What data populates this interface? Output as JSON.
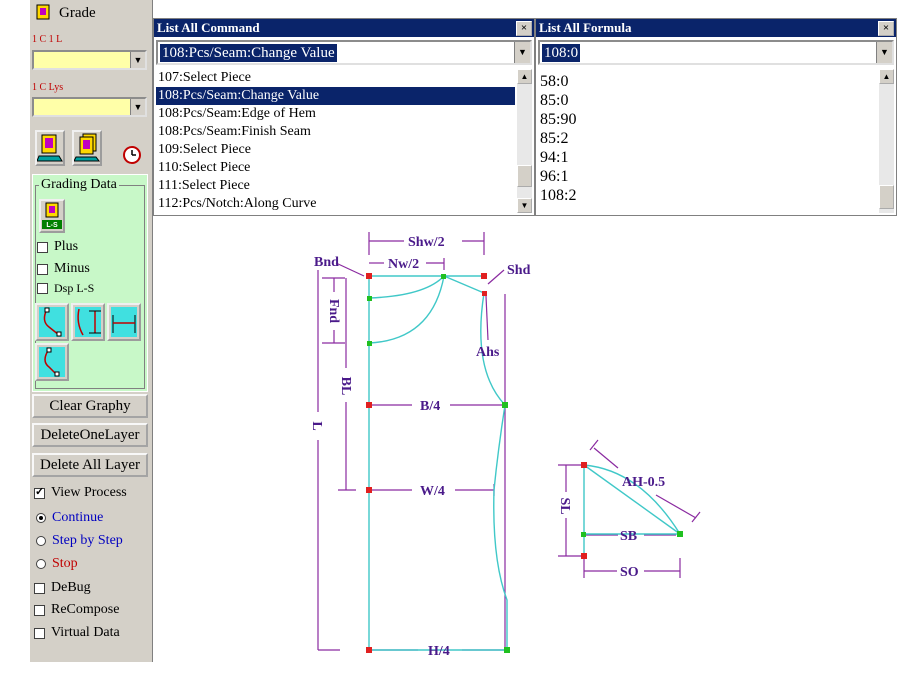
{
  "panel": {
    "title": "Grade",
    "label_1": "1 C 1 L",
    "label_2": "1 C Lys",
    "grading_legend": "Grading Data",
    "ls_button": "L-S",
    "checks": [
      {
        "label": "Plus",
        "checked": false
      },
      {
        "label": "Minus",
        "checked": false
      },
      {
        "label": "Dsp L-S",
        "checked": false
      }
    ],
    "buttons": [
      "Clear Graphy",
      "DeleteOneLayer",
      "Delete All Layer"
    ],
    "view_process": {
      "label": "View Process",
      "checked": true
    },
    "radios": [
      {
        "label": "Continue",
        "selected": true,
        "color": "#0000c0"
      },
      {
        "label": "Step by Step",
        "selected": false,
        "color": "#0000c0"
      },
      {
        "label": "Stop",
        "selected": false,
        "color": "#c00000"
      }
    ],
    "options": [
      {
        "label": "DeBug",
        "checked": false
      },
      {
        "label": "ReCompose",
        "checked": false
      },
      {
        "label": "Virtual Data",
        "checked": false
      }
    ]
  },
  "command_window": {
    "title": "List All Command",
    "close": "×",
    "selected": "108:Pcs/Seam:Change Value",
    "items": [
      "107:Select Piece",
      "108:Pcs/Seam:Change Value",
      "108:Pcs/Seam:Edge of Hem",
      "108:Pcs/Seam:Finish Seam",
      "109:Select Piece",
      "110:Select Piece",
      "111:Select Piece",
      "112:Pcs/Notch:Along Curve"
    ],
    "selected_index": 1
  },
  "formula_window": {
    "title": "List All Formula",
    "close": "×",
    "selected": "108:0",
    "items": [
      "58:0",
      "85:0",
      "85:90",
      "85:2",
      "94:1",
      "96:1",
      "108:2"
    ]
  },
  "diagram": {
    "labels": {
      "shw2": "Shw/2",
      "nw2": "Nw/2",
      "bnd": "Bnd",
      "shd": "Shd",
      "fnd": "Fnd",
      "ahs": "Ahs",
      "bl": "BL",
      "b4": "B/4",
      "l": "L",
      "w4": "W/4",
      "h4": "H/4",
      "ah": "AH-0.5",
      "sl": "SL",
      "sb": "SB",
      "so": "SO"
    },
    "colors": {
      "pattern": "#40c8c8",
      "dim": "#8a2aa0",
      "point_red": "#e02020",
      "point_green": "#20c020"
    }
  }
}
